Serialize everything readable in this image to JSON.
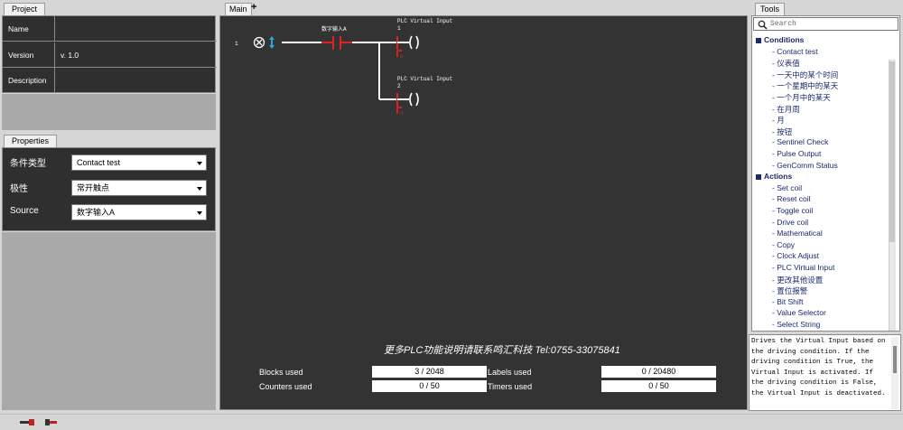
{
  "project": {
    "tab": "Project",
    "rows": [
      {
        "key": "Name",
        "value": ""
      },
      {
        "key": "Version",
        "value": "v. 1.0"
      },
      {
        "key": "Description",
        "value": ""
      }
    ]
  },
  "properties": {
    "tab": "Properties",
    "fields": [
      {
        "label": "条件类型",
        "value": "Contact test"
      },
      {
        "label": "极性",
        "value": "常开触点"
      },
      {
        "label": "Source",
        "value": "数字输入A"
      }
    ]
  },
  "main": {
    "tab": "Main",
    "add_tab": "+",
    "rung_number": "1",
    "contact_label": "数字输入A",
    "coil1_label": "PLC Virtual Input",
    "coil1_num": "1",
    "coil2_label": "PLC Virtual Input",
    "coil2_num": "2",
    "promo": "更多PLC功能说明请联系鸣汇科技 Tel:0755-33075841",
    "stats": {
      "blocks_label": "Blocks used",
      "blocks_value": "3 / 2048",
      "labels_label": "Labels used",
      "labels_value": "0 / 20480",
      "counters_label": "Counters used",
      "counters_value": "0 / 50",
      "timers_label": "Timers used",
      "timers_value": "0 / 50"
    }
  },
  "tools": {
    "tab": "Tools",
    "search_placeholder": "Search",
    "conditions_label": "Conditions",
    "conditions": [
      "Contact test",
      "仪表值",
      "一天中的某个时间",
      "一个星期中的某天",
      "一个月中的某天",
      "在月周",
      "月",
      "按钮",
      "Sentinel Check",
      "Pulse Output",
      "GenComm Status"
    ],
    "actions_label": "Actions",
    "actions": [
      "Set coil",
      "Reset coil",
      "Toggle coil",
      "Drive coil",
      "Mathematical",
      "Copy",
      "Clock Adjust",
      "PLC Virtual Input",
      "更改其他设置",
      "置位报警",
      "Bit Shift",
      "Value Selector",
      "Select String"
    ],
    "description": "Drives the Virtual Input based on the driving condition. If the driving condition is True, the Virtual Input is activated. If the driving condition is False, the Virtual Input is deactivated."
  },
  "colors": {
    "canvas": "#333333",
    "contact": "#e0202a",
    "accent_blue": "#1a2a6c"
  }
}
